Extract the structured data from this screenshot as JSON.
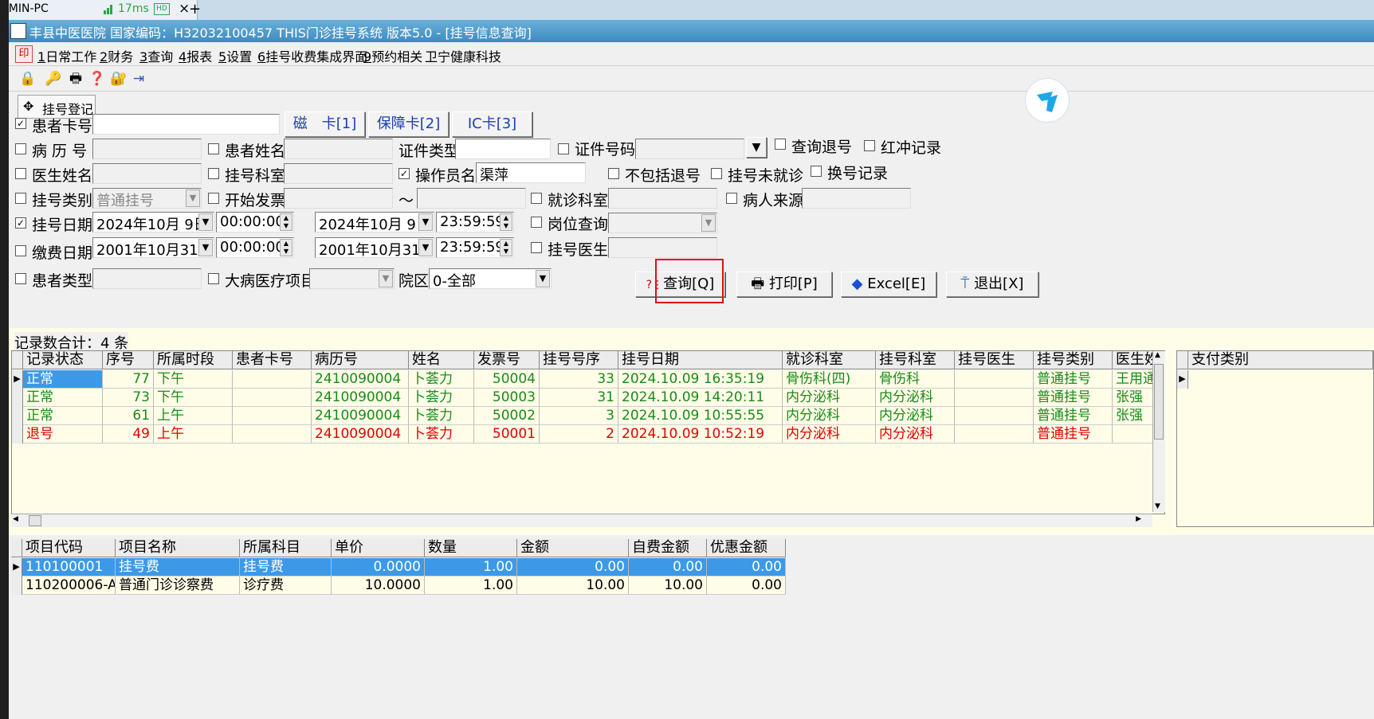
{
  "browser": {
    "tab_title": "DMIN-PC",
    "ping": "17ms",
    "hd": "HD",
    "close": "×",
    "new_tab": "+"
  },
  "window": {
    "title": "丰县中医医院 国家编码：H32032100457 THIS门诊挂号系统 版本5.0 - [挂号信息查询]"
  },
  "menu": [
    {
      "key": "1",
      "label": "日常工作"
    },
    {
      "key": "2",
      "label": "财务"
    },
    {
      "key": "3",
      "label": "查询"
    },
    {
      "key": "4",
      "label": "报表"
    },
    {
      "key": "5",
      "label": "设置"
    },
    {
      "key": "6",
      "label": "挂号收费集成界面"
    },
    {
      "key": "9",
      "label": "预约相关"
    },
    {
      "key": "",
      "label": "卫宁健康科技"
    }
  ],
  "toolbar": {
    "reg_tab": "挂号登记"
  },
  "form": {
    "card_no": {
      "label": "患者卡号",
      "value": "",
      "checked": true
    },
    "card_buttons": [
      "磁　卡[1]",
      "保障卡[2]",
      "IC卡[3]"
    ],
    "record_no": {
      "label": "病 历 号",
      "value": ""
    },
    "patient_name": {
      "label": "患者姓名",
      "value": ""
    },
    "id_type": {
      "label": "证件类型",
      "value": ""
    },
    "id_no": {
      "label": "证件号码",
      "value": ""
    },
    "query_refund": {
      "label": "查询退号"
    },
    "red_record": {
      "label": "红冲记录"
    },
    "doctor_name": {
      "label": "医生姓名",
      "value": ""
    },
    "reg_dept": {
      "label": "挂号科室",
      "value": ""
    },
    "operator": {
      "label": "操作员名",
      "value": "渠萍",
      "checked": true
    },
    "exclude_refund": {
      "label": "不包括退号"
    },
    "not_visited": {
      "label": "挂号未就诊"
    },
    "change_record": {
      "label": "换号记录"
    },
    "reg_type": {
      "label": "挂号类别",
      "value": "普通挂号"
    },
    "start_invoice": {
      "label": "开始发票",
      "value": "",
      "tilde": "～"
    },
    "visit_dept": {
      "label": "就诊科室",
      "value": ""
    },
    "patient_source": {
      "label": "病人来源",
      "value": ""
    },
    "reg_date": {
      "label": "挂号日期",
      "checked": true,
      "from_date": "2024年10月 9日",
      "from_time": "00:00:00",
      "to_date": "2024年10月 9日",
      "to_time": "23:59:59"
    },
    "post_query": {
      "label": "岗位查询",
      "value": ""
    },
    "pay_date": {
      "label": "缴费日期",
      "from_date": "2001年10月31日",
      "from_time": "00:00:00",
      "to_date": "2001年10月31日",
      "to_time": "23:59:59"
    },
    "reg_doctor": {
      "label": "挂号医生",
      "value": ""
    },
    "patient_type": {
      "label": "患者类型",
      "value": ""
    },
    "major_illness": {
      "label": "大病医疗项目",
      "value": ""
    },
    "campus": {
      "label": "院区",
      "value": "0-全部"
    }
  },
  "actions": {
    "query": "查询[Q]",
    "print": "打印[P]",
    "excel": "Excel[E]",
    "exit": "退出[X]"
  },
  "summary": {
    "record_count": "记录数合计：4 条"
  },
  "main_table": {
    "columns": [
      "记录状态",
      "序号",
      "所属时段",
      "患者卡号",
      "病历号",
      "姓名",
      "发票号",
      "挂号号序",
      "挂号日期",
      "就诊科室",
      "挂号科室",
      "挂号医生",
      "挂号类别",
      "医生姓"
    ],
    "rows": [
      {
        "cells": [
          "正常",
          "77",
          "下午",
          "",
          "2410090004",
          "卜荟力",
          "50004",
          "33",
          "2024.10.09 16:35:19",
          "骨伤科(四)",
          "骨伤科",
          "",
          "普通挂号",
          "王用通"
        ],
        "status": "normal",
        "selected": true
      },
      {
        "cells": [
          "正常",
          "73",
          "下午",
          "",
          "2410090004",
          "卜荟力",
          "50003",
          "31",
          "2024.10.09 14:20:11",
          "内分泌科",
          "内分泌科",
          "",
          "普通挂号",
          "张强"
        ],
        "status": "normal"
      },
      {
        "cells": [
          "正常",
          "61",
          "上午",
          "",
          "2410090004",
          "卜荟力",
          "50002",
          "3",
          "2024.10.09 10:55:55",
          "内分泌科",
          "内分泌科",
          "",
          "普通挂号",
          "张强"
        ],
        "status": "normal"
      },
      {
        "cells": [
          "退号",
          "49",
          "上午",
          "",
          "2410090004",
          "卜荟力",
          "50001",
          "2",
          "2024.10.09 10:52:19",
          "内分泌科",
          "内分泌科",
          "",
          "普通挂号",
          ""
        ],
        "status": "refund"
      }
    ]
  },
  "payment_table": {
    "columns": [
      "支付类别"
    ]
  },
  "fee_table": {
    "columns": [
      "项目代码",
      "项目名称",
      "所属科目",
      "单价",
      "数量",
      "金额",
      "自费金额",
      "优惠金额"
    ],
    "rows": [
      {
        "cells": [
          "110100001",
          "挂号费",
          "挂号费",
          "0.0000",
          "1.00",
          "0.00",
          "0.00",
          "0.00"
        ],
        "selected": true
      },
      {
        "cells": [
          "110200006-A",
          "普通门诊诊察费",
          "诊疗费",
          "10.0000",
          "1.00",
          "10.00",
          "10.00",
          "0.00"
        ]
      }
    ]
  },
  "colors": {
    "title_bar": "#3e8bc2",
    "grid_bg": "#fffde8",
    "selected": "#3d99e8",
    "normal_text": "#1a8a1a",
    "refund_text": "#e00000",
    "highlight_box": "#e01010"
  }
}
